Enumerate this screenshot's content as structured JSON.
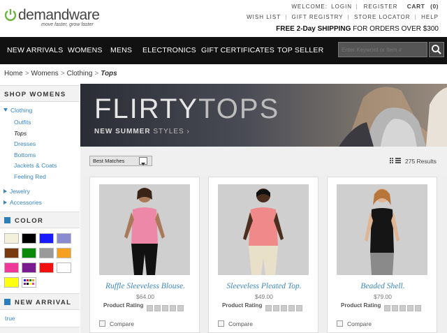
{
  "header": {
    "logo_text": "demandware",
    "logo_tagline": "move faster, grow faster",
    "welcome": "WELCOME:",
    "login": "LOGIN",
    "register": "REGISTER",
    "cart": "CART",
    "cart_count": "(0)",
    "wish_list": "WISH LIST",
    "gift_registry": "GIFT REGISTRY",
    "store_locator": "STORE LOCATOR",
    "help": "HELP",
    "promo_bold": "FREE 2-Day SHIPPING",
    "promo_rest": " FOR ORDERS OVER $300",
    "separator": "|"
  },
  "nav": {
    "items": [
      "NEW ARRIVALS",
      "WOMENS",
      "MENS",
      "ELECTRONICS",
      "GIFT CERTIFICATES",
      "TOP SELLER"
    ],
    "search_placeholder": "Enter Keyword or Item #"
  },
  "breadcrumb": {
    "items": [
      "Home",
      "Womens",
      "Clothing"
    ],
    "current": "Tops",
    "separator": ">"
  },
  "sidebar": {
    "shop_heading": "SHOP WOMENS",
    "clothing": "Clothing",
    "sub_items": [
      "Outfits",
      "Tops",
      "Dresses",
      "Bottoms",
      "Jackets & Coats",
      "Feeling Red"
    ],
    "jewelry": "Jewelry",
    "accessories": "Accessories",
    "color_heading": "COLOR",
    "swatches": [
      "#f3f0dc",
      "#000000",
      "#1a1aff",
      "#8a8ad0",
      "#7a3a10",
      "#0a8a0a",
      "#9a9a9a",
      "#f5a020",
      "#f0389a",
      "#7a1a90",
      "#f01010",
      "#ffffff",
      "#ffff10"
    ],
    "new_arrival_heading": "NEW ARRIVAL",
    "new_arrival_value": "true"
  },
  "banner": {
    "title_bold": "FLIRTY",
    "title_thin": "TOPS",
    "sub_bold": "NEW SUMMER",
    "sub_rest": " STYLES",
    "chevron": "›"
  },
  "results": {
    "sort_label": "Best Matches",
    "count": "275 Results"
  },
  "products": [
    {
      "name": "Ruffle Sleeveless Blouse.",
      "price": "$64.00",
      "rating_label": "Product Rating",
      "compare": "Compare",
      "top_color": "#ee88a8",
      "bottom_color": "#111111"
    },
    {
      "name": "Sleeveless Pleated Top.",
      "price": "$49.00",
      "rating_label": "Product Rating",
      "compare": "Compare",
      "top_color": "#f08a8a",
      "bottom_color": "#e8e0c8"
    },
    {
      "name": "Beaded Shell.",
      "price": "$79.00",
      "rating_label": "Product Rating",
      "compare": "Compare",
      "top_color": "#151515",
      "bottom_color": "#8a8a8a"
    }
  ],
  "colors": {
    "nav_bg": "#111111",
    "link_blue": "#3a86c0",
    "logo_green": "#6cb33f"
  }
}
